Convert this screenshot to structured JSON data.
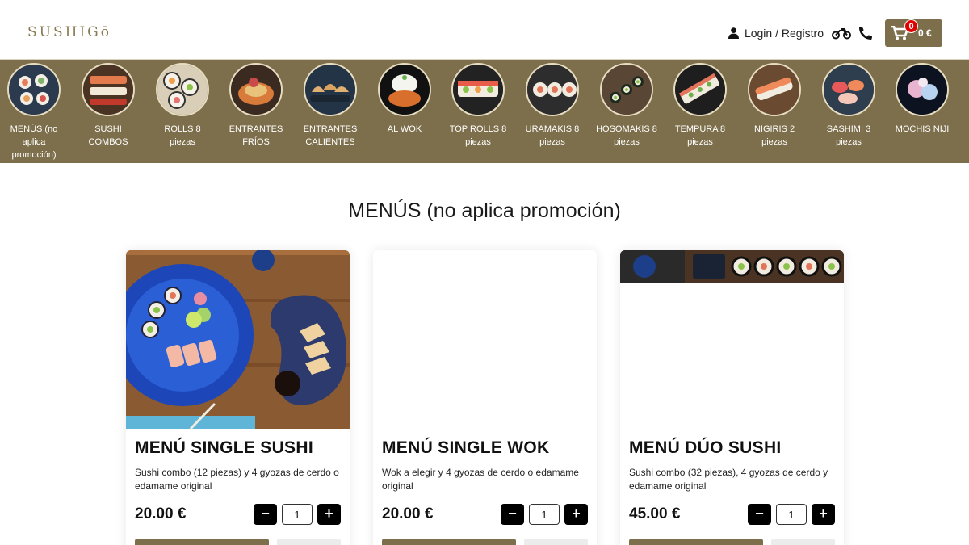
{
  "header": {
    "logo": "SUSHIGō",
    "login_label": "Login / Registro",
    "cart_count": "0",
    "cart_total": "0 €"
  },
  "categories": [
    {
      "label": "MENÚS (no aplica promoción)",
      "icon": "menus-thumbnail"
    },
    {
      "label": "SUSHI COMBOS",
      "icon": "sushi-combos-thumbnail"
    },
    {
      "label": "ROLLS 8 piezas",
      "icon": "rolls-thumbnail"
    },
    {
      "label": "ENTRANTES FRÍOS",
      "icon": "cold-starters-thumbnail"
    },
    {
      "label": "ENTRANTES CALIENTES",
      "icon": "hot-starters-thumbnail"
    },
    {
      "label": "AL WOK",
      "icon": "wok-thumbnail"
    },
    {
      "label": "TOP ROLLS 8 piezas",
      "icon": "top-rolls-thumbnail"
    },
    {
      "label": "URAMAKIS 8 piezas",
      "icon": "uramakis-thumbnail"
    },
    {
      "label": "HOSOMAKIS 8 piezas",
      "icon": "hosomakis-thumbnail"
    },
    {
      "label": "TEMPURA 8 piezas",
      "icon": "tempura-thumbnail"
    },
    {
      "label": "NIGIRIS 2 piezas",
      "icon": "nigiris-thumbnail"
    },
    {
      "label": "SASHIMI 3 piezas",
      "icon": "sashimi-thumbnail"
    },
    {
      "label": "MOCHIS NIJI",
      "icon": "mochis-thumbnail"
    }
  ],
  "section": {
    "title": "MENÚS (no aplica promoción)"
  },
  "products": [
    {
      "name": "MENÚ SINGLE SUSHI",
      "description": "Sushi combo (12 piezas) y 4 gyozas de cerdo o edamame original",
      "price": "20.00 €",
      "quantity": "1",
      "minus": "−",
      "plus": "+"
    },
    {
      "name": "MENÚ SINGLE WOK",
      "description": "Wok a elegir y 4 gyozas de cerdo o edamame original",
      "price": "20.00 €",
      "quantity": "1",
      "minus": "−",
      "plus": "+"
    },
    {
      "name": "MENÚ DÚO SUSHI",
      "description": "Sushi combo (32 piezas), 4 gyozas de cerdo y edamame original",
      "price": "45.00 €",
      "quantity": "1",
      "minus": "−",
      "plus": "+"
    }
  ],
  "colors": {
    "brand": "#7d6f4b",
    "badge": "#e00000"
  }
}
